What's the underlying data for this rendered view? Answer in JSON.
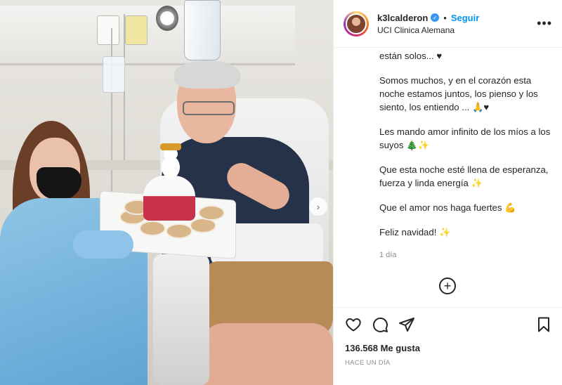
{
  "post": {
    "carousel_next_glyph": "›"
  },
  "header": {
    "username": "k3lcalderon",
    "verified_glyph": "✓",
    "separator": "•",
    "follow_label": "Seguir",
    "location": "UCI Clinica Alemana",
    "more_glyph": "•••"
  },
  "caption": {
    "lines": [
      "están solos... ♥",
      "Somos muchos, y en el corazón esta noche estamos juntos, los pienso y los siento, los entiendo ... 🙏♥",
      "Les mando amor infinito de los míos a los suyos 🎄✨",
      "Que esta noche esté llena de esperanza, fuerza y linda energía ✨",
      "Que el amor nos haga fuertes 💪",
      "Feliz navidad! ✨"
    ],
    "time_ago": "1 día"
  },
  "add_comment_glyph": "+",
  "actions": {
    "likes": "136.568 Me gusta",
    "timestamp": "HACE UN DÍA"
  },
  "icons": {
    "like": "heart-icon",
    "comment": "comment-icon",
    "share": "share-icon",
    "save": "bookmark-icon",
    "verified": "verified-badge-icon",
    "more": "more-options-icon",
    "add": "add-comment-icon"
  },
  "colors": {
    "follow": "#0095f6",
    "verified": "#3897f0",
    "muted": "#8e8e8e",
    "text": "#262626"
  }
}
